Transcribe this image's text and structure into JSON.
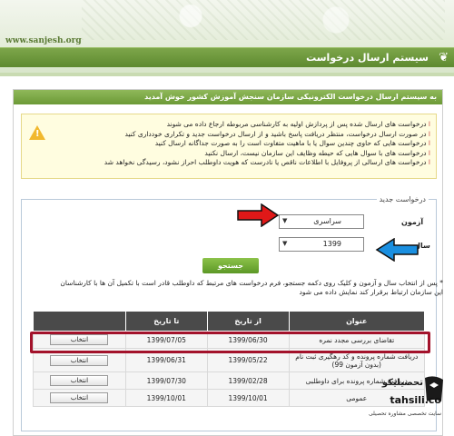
{
  "site_url": "www.sanjesh.org",
  "header": {
    "title": "سیستم ارسال درخواست"
  },
  "panel": {
    "heading": "به سیستم ارسال درخواست الکترونیکی سازمان سنجش آموزش کشور خوش آمدید"
  },
  "notice": {
    "items": [
      "درخواست های ارسال شده پس از پردازش اولیه به کارشناسی مربوطه ارجاع داده می شوند",
      "در صورت ارسال درخواست، منتظر دریافت پاسخ باشید و از ارسال درخواست جدید و تکراری خودداری کنید",
      "درخواست هایی که حاوی چندین سوال یا با ماهیت متفاوت است را به صورت جداگانه ارسال کنید",
      "درخواست های با سوال هایی که حیطه وظایف این سازمان نیست، ارسال نکنید",
      "درخواست های ارسالی از پروفایل با اطلاعات ناقص یا نادرست که هویت داوطلب احراز نشود، رسیدگی نخواهد شد"
    ]
  },
  "form": {
    "legend": "درخواست جدید",
    "exam_label": "آزمون",
    "exam_value": "سراسری",
    "year_label": "سال",
    "year_value": "1399",
    "search_label": "جستجو",
    "hint": "* پس از انتخاب سال و آزمون و کلیک روی دکمه جستجو، فرم درخواست های مرتبط که داوطلب قادر است با تکمیل آن ها با کارشناسان این سازمان ارتباط برقرار کند نمایش داده می شود"
  },
  "table": {
    "headers": [
      "عنوان",
      "از تاریخ",
      "تا تاریخ",
      ""
    ],
    "rows": [
      {
        "title": "تقاضای بررسی مجدد نمره",
        "from": "1399/06/30",
        "to": "1399/07/05",
        "action": "انتخاب"
      },
      {
        "title": "دریافت شماره پرونده و کد رهگیری ثبت نام (بدون آزمون 99)",
        "from": "1399/05/22",
        "to": "1399/06/31",
        "action": "انتخاب"
      },
      {
        "title": "دریافت شماره پرونده برای داوطلبی",
        "from": "1399/02/28",
        "to": "1399/07/30",
        "action": "انتخاب"
      },
      {
        "title": "عمومی",
        "from": "1399/10/01",
        "to": "1399/10/01",
        "action": "انتخاب"
      }
    ]
  },
  "watermark": {
    "brand": "تحصیلیکو",
    "domain": "tahsili.co",
    "tagline": "سایت تخصصی مشاوره تحصیلی"
  },
  "colors": {
    "accent": "#5e8a30",
    "highlight": "#a3122b",
    "arrow_red": "#e01818",
    "arrow_blue": "#1a8fe0"
  }
}
